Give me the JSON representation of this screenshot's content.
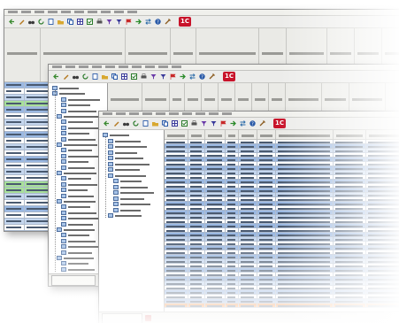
{
  "app": {
    "logo_text": "1С"
  },
  "toolbar_icons": [
    {
      "icon": "nav-back-icon",
      "color": "#3a8a30"
    },
    {
      "icon": "pencil-icon",
      "color": "#b4781e"
    },
    {
      "icon": "binoculars-icon",
      "color": "#3c3c3c"
    },
    {
      "icon": "refresh-icon",
      "color": "#2a7a2a"
    },
    {
      "icon": "document-icon",
      "color": "#2a5aa8"
    },
    {
      "icon": "folder-icon",
      "color": "#d8a830"
    },
    {
      "icon": "copy-icon",
      "color": "#2a5aa8"
    },
    {
      "icon": "grid-icon",
      "color": "#3a3a9a"
    },
    {
      "icon": "checkbox-icon",
      "color": "#2a7a2a"
    },
    {
      "icon": "print-icon",
      "color": "#555555"
    },
    {
      "icon": "filter-icon",
      "color": "#6a3aa8"
    },
    {
      "icon": "funnel-icon",
      "color": "#3a3a9a"
    },
    {
      "icon": "red-flag-icon",
      "color": "#c82828"
    },
    {
      "icon": "green-arrow-icon",
      "color": "#2a8a2a"
    },
    {
      "icon": "exchange-icon",
      "color": "#2a6aa8"
    },
    {
      "icon": "help-icon",
      "color": "#2a5aa8"
    },
    {
      "icon": "tools-icon",
      "color": "#8a5a1e"
    }
  ],
  "colors": {
    "row_blue": "#9ab8e2",
    "row_alt": "#c4d6ee",
    "row_white": "#ffffff",
    "row_selected": "#f08a3c",
    "row_green": "#a8e09a",
    "tree_bg": "#ffffff",
    "chrome": "#f2f2ee"
  },
  "back_window": {
    "menu": [
      "",
      "",
      "",
      "",
      "",
      "",
      "",
      "",
      "",
      ""
    ],
    "header_cells": [
      "",
      "",
      "",
      "",
      "",
      "",
      "",
      "",
      "",
      ""
    ]
  },
  "middle_window": {
    "menu": [
      "",
      "",
      "",
      "",
      "",
      "",
      "",
      "",
      "",
      ""
    ],
    "header_cells": [
      "",
      "",
      "",
      "",
      "",
      "",
      "",
      "",
      "",
      "",
      "",
      ""
    ],
    "status_button": ""
  },
  "front_window": {
    "menu": [
      "",
      "",
      "",
      "",
      "",
      "",
      "",
      "",
      "",
      ""
    ],
    "tree": [
      {
        "level": 0,
        "label": ""
      },
      {
        "level": 1,
        "label": ""
      },
      {
        "level": 1,
        "label": ""
      },
      {
        "level": 1,
        "label": ""
      },
      {
        "level": 1,
        "label": ""
      },
      {
        "level": 1,
        "label": ""
      },
      {
        "level": 1,
        "label": ""
      },
      {
        "level": 1,
        "label": ""
      },
      {
        "level": 2,
        "label": ""
      },
      {
        "level": 2,
        "label": ""
      },
      {
        "level": 2,
        "label": ""
      },
      {
        "level": 2,
        "label": ""
      },
      {
        "level": 2,
        "label": ""
      },
      {
        "level": 2,
        "label": ""
      },
      {
        "level": 1,
        "label": ""
      }
    ],
    "grid_headers": [
      "",
      "",
      "",
      "",
      "",
      "",
      "",
      "",
      ""
    ],
    "grid_row_count": 38,
    "selected_row": 37,
    "status_button": ""
  }
}
